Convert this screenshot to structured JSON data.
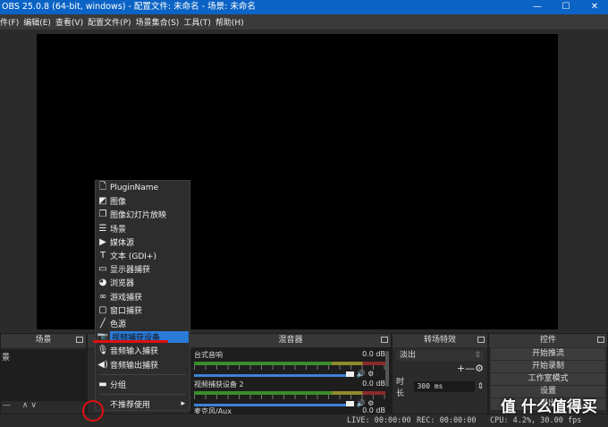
{
  "window": {
    "title": "OBS 25.0.8 (64-bit, windows) - 配置文件: 未命名 - 场景: 未命名",
    "minimize": "—",
    "maximize": "☐",
    "close": "✕"
  },
  "menubar": [
    "件(F)",
    "编辑(E)",
    "查看(V)",
    "配置文件(P)",
    "场景集合(S)",
    "工具(T)",
    "帮助(H)"
  ],
  "scenes": {
    "title": "场景",
    "items": [
      "景"
    ],
    "controls": [
      "—",
      "∧",
      "∨"
    ]
  },
  "add_menu": {
    "items": [
      {
        "icon": "file-icon",
        "glyph": "🗋",
        "label": "PluginName"
      },
      {
        "icon": "image-icon",
        "glyph": "◩",
        "label": "图像"
      },
      {
        "icon": "slideshow-icon",
        "glyph": "❐",
        "label": "图像幻灯片放映"
      },
      {
        "icon": "list-icon",
        "glyph": "☰",
        "label": "场景"
      },
      {
        "icon": "play-icon",
        "glyph": "▶",
        "label": "媒体源"
      },
      {
        "icon": "text-icon",
        "glyph": "T",
        "label": "文本 (GDI+)"
      },
      {
        "icon": "monitor-icon",
        "glyph": "▭",
        "label": "显示器捕获"
      },
      {
        "icon": "globe-icon",
        "glyph": "◕",
        "label": "浏览器"
      },
      {
        "icon": "gamepad-icon",
        "glyph": "∞",
        "label": "游戏捕获"
      },
      {
        "icon": "window-icon",
        "glyph": "▢",
        "label": "窗口捕获"
      },
      {
        "icon": "brush-icon",
        "glyph": "╱",
        "label": "色源"
      },
      {
        "icon": "camera-icon",
        "glyph": "📷",
        "label": "视频捕获设备",
        "selected": true
      },
      {
        "icon": "microphone-icon",
        "glyph": "🎙",
        "label": "音频输入捕获"
      },
      {
        "icon": "speaker-icon",
        "glyph": "◀)",
        "label": "音频输出捕获"
      }
    ],
    "group": {
      "icon": "folder-icon",
      "glyph": "▬",
      "label": "分组"
    },
    "deprecated": {
      "label": "不推荐使用",
      "arrow": "▸"
    }
  },
  "mixer": {
    "title": "混音器",
    "channels": [
      {
        "name": "台式音响",
        "level": "0.0 dB"
      },
      {
        "name": "视频捕获设备 2",
        "level": "0.0 dB"
      },
      {
        "name": "麦克风/Aux",
        "level": "0.0 dB"
      }
    ]
  },
  "transitions": {
    "title": "转场特效",
    "selected": "淡出",
    "duration_label": "时长",
    "duration": "300 ms",
    "add": "+",
    "remove": "—"
  },
  "controls": {
    "title": "控件",
    "buttons": [
      "开始推流",
      "开始录制",
      "工作室模式",
      "设置",
      "退出"
    ]
  },
  "status": {
    "live": "LIVE: 00:00:00",
    "rec": "REC: 00:00:00",
    "cpu": "CPU: 4.2%, 30.00 fps"
  },
  "watermark": "值 什么值得买",
  "colors": {
    "titlebar": "#0b63c5",
    "selection": "#2a7bd8",
    "annotation": "#e01010"
  }
}
